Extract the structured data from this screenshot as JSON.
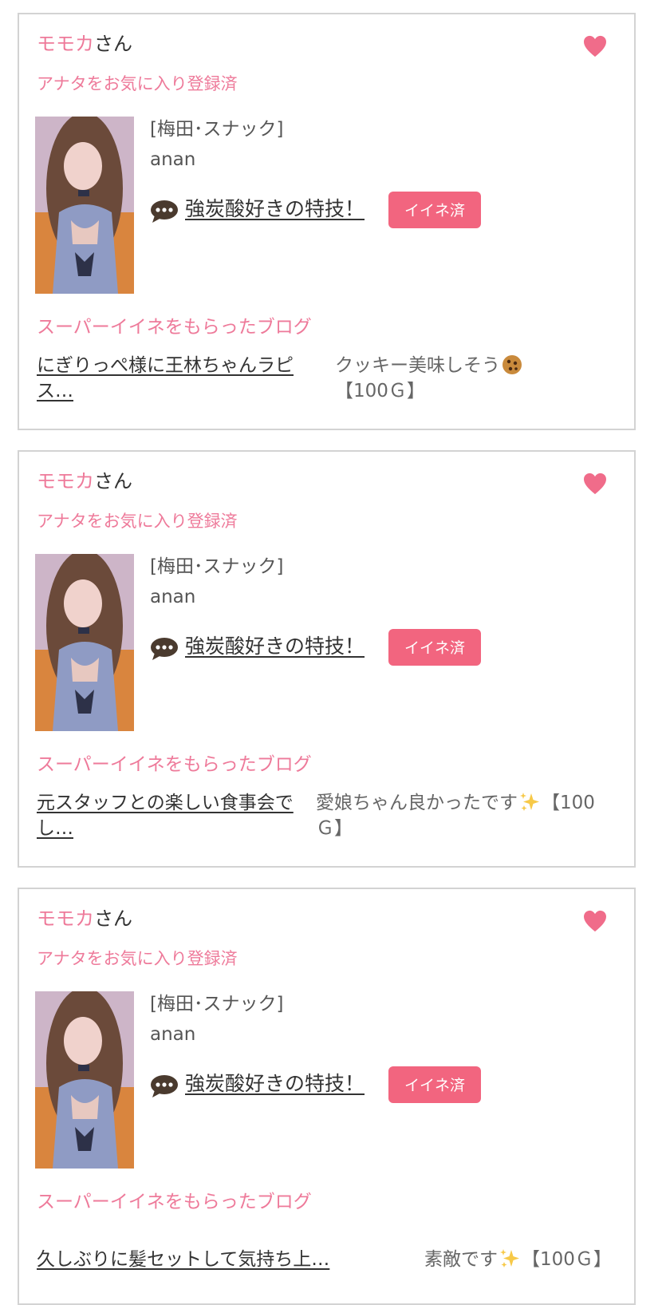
{
  "cards": [
    {
      "name": "モモカ",
      "name_suffix": "さん",
      "favorite_status": "アナタをお気に入り登録済",
      "area": "[梅田･スナック]",
      "shop": "anan",
      "post_title": "強炭酸好きの特技！",
      "like_button": "イイネ済",
      "super_like_heading": "スーパーイイネをもらったブログ",
      "blog_title": "にぎりっぺ様に王林ちゃんラピス…",
      "blog_comment_before": "クッキー美味しそう",
      "blog_comment_emoji": "cookie-emoji",
      "blog_comment_after": "【100Ｇ】"
    },
    {
      "name": "モモカ",
      "name_suffix": "さん",
      "favorite_status": "アナタをお気に入り登録済",
      "area": "[梅田･スナック]",
      "shop": "anan",
      "post_title": "強炭酸好きの特技！",
      "like_button": "イイネ済",
      "super_like_heading": "スーパーイイネをもらったブログ",
      "blog_title": "元スタッフとの楽しい食事会でし…",
      "blog_comment_before": "愛娘ちゃん良かったです",
      "blog_comment_emoji": "sparkles-emoji",
      "blog_comment_after": "【100Ｇ】"
    },
    {
      "name": "モモカ",
      "name_suffix": "さん",
      "favorite_status": "アナタをお気に入り登録済",
      "area": "[梅田･スナック]",
      "shop": "anan",
      "post_title": "強炭酸好きの特技！",
      "like_button": "イイネ済",
      "super_like_heading": "スーパーイイネをもらったブログ",
      "blog_title": "久しぶりに髪セットして気持ち上…",
      "blog_comment_before": "素敵です",
      "blog_comment_emoji": "sparkles-emoji",
      "blog_comment_after": "【100Ｇ】"
    }
  ],
  "colors": {
    "accent_pink": "#ee7a9a",
    "button_pink": "#f2657f",
    "heart_pink": "#f06c8a",
    "card_border": "#d3d3d3"
  },
  "icons": {
    "favorite": "heart-icon",
    "comment": "speech-bubble-icon"
  }
}
